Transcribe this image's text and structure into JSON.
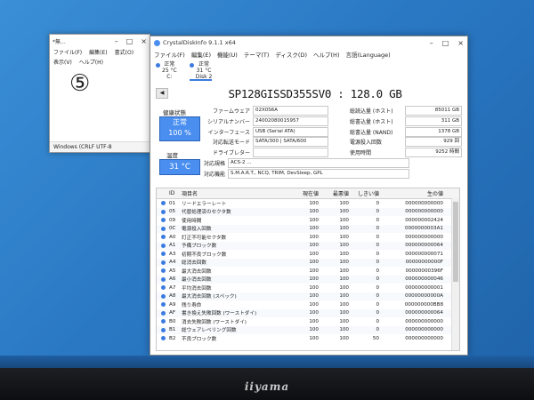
{
  "notepad": {
    "title": "*無...",
    "menu": [
      "ファイル(F)",
      "編集(E)",
      "書式(O)",
      "表示(V)",
      "ヘルプ(H)"
    ],
    "content": "⑤",
    "status": "Windows (CRLF  UTF-8"
  },
  "cdi": {
    "title": "CrystalDiskInfo 9.1.1 x64",
    "menu": [
      "ファイル(F)",
      "編集(E)",
      "機能(U)",
      "テーマ(T)",
      "ディスク(D)",
      "ヘルプ(H)",
      "言語(Language)"
    ],
    "disks": [
      {
        "status": "正常",
        "temp": "25 °C",
        "name": "C:"
      },
      {
        "status": "正常",
        "temp": "31 °C",
        "name": "Disk 2"
      }
    ],
    "model": "SP128GISSD355SV0 : 128.0 GB",
    "health_label": "健康状態",
    "health_status": "正常",
    "health_percent": "100 %",
    "temp_label": "温度",
    "temp_value": "31 °C",
    "fields_left": [
      {
        "label": "ファームウェア",
        "value": "02X0S6A"
      },
      {
        "label": "シリアルナンバー",
        "value": "24002080015957"
      },
      {
        "label": "インターフェース",
        "value": "USB (Serial ATA)"
      },
      {
        "label": "対応転送モード",
        "value": "SATA/300 | SATA/600"
      },
      {
        "label": "ドライブレター",
        "value": ""
      },
      {
        "label": "対応規格",
        "value": "ACS-2 ..."
      },
      {
        "label": "対応機能",
        "value": "S.M.A.R.T., NCQ, TRIM, DevSleep, GPL"
      }
    ],
    "fields_right": [
      {
        "label": "総読込量 (ホスト)",
        "value": "85011 GB"
      },
      {
        "label": "総書込量 (ホスト)",
        "value": "311 GB"
      },
      {
        "label": "総書込量 (NAND)",
        "value": "1378 GB"
      },
      {
        "label": "電源投入回数",
        "value": "929 回"
      },
      {
        "label": "使用時間",
        "value": "9252 時間"
      }
    ],
    "table_headers": [
      "ID",
      "項目名",
      "現在値",
      "最悪値",
      "しきい値",
      "生の値"
    ],
    "table_rows": [
      {
        "id": "01",
        "name": "リードエラーレート",
        "cur": "100",
        "worst": "100",
        "thr": "0",
        "raw": "000000000000"
      },
      {
        "id": "05",
        "name": "代替処理済のセクタ数",
        "cur": "100",
        "worst": "100",
        "thr": "0",
        "raw": "000000000000"
      },
      {
        "id": "09",
        "name": "使用時間",
        "cur": "100",
        "worst": "100",
        "thr": "0",
        "raw": "000000002424"
      },
      {
        "id": "0C",
        "name": "電源投入回数",
        "cur": "100",
        "worst": "100",
        "thr": "0",
        "raw": "0000000003A1"
      },
      {
        "id": "A0",
        "name": "訂正不可能セクタ数",
        "cur": "100",
        "worst": "100",
        "thr": "0",
        "raw": "000000000000"
      },
      {
        "id": "A1",
        "name": "予備ブロック数",
        "cur": "100",
        "worst": "100",
        "thr": "0",
        "raw": "000000000064"
      },
      {
        "id": "A3",
        "name": "初期不良ブロック数",
        "cur": "100",
        "worst": "100",
        "thr": "0",
        "raw": "000000000071"
      },
      {
        "id": "A4",
        "name": "総消去回数",
        "cur": "100",
        "worst": "100",
        "thr": "0",
        "raw": "00000000000F"
      },
      {
        "id": "A5",
        "name": "最大消去回数",
        "cur": "100",
        "worst": "100",
        "thr": "0",
        "raw": "00000000396F"
      },
      {
        "id": "A6",
        "name": "最小消去回数",
        "cur": "100",
        "worst": "100",
        "thr": "0",
        "raw": "000000000046"
      },
      {
        "id": "A7",
        "name": "平均消去回数",
        "cur": "100",
        "worst": "100",
        "thr": "0",
        "raw": "000000000001"
      },
      {
        "id": "A8",
        "name": "最大消去回数 (スペック)",
        "cur": "100",
        "worst": "100",
        "thr": "0",
        "raw": "00000000000A"
      },
      {
        "id": "A9",
        "name": "残り寿命",
        "cur": "100",
        "worst": "100",
        "thr": "0",
        "raw": "000000000BB8"
      },
      {
        "id": "AF",
        "name": "書き換え失敗回数 (ワーストダイ)",
        "cur": "100",
        "worst": "100",
        "thr": "0",
        "raw": "000000000064"
      },
      {
        "id": "B0",
        "name": "消去失敗回数 (ワーストダイ)",
        "cur": "100",
        "worst": "100",
        "thr": "0",
        "raw": "000000000000"
      },
      {
        "id": "B1",
        "name": "総ウェアレベリング回数",
        "cur": "100",
        "worst": "100",
        "thr": "0",
        "raw": "000000000000"
      },
      {
        "id": "B2",
        "name": "不良ブロック数",
        "cur": "100",
        "worst": "100",
        "thr": "50",
        "raw": "000000000000"
      }
    ]
  },
  "monitor_brand": "iiyama"
}
